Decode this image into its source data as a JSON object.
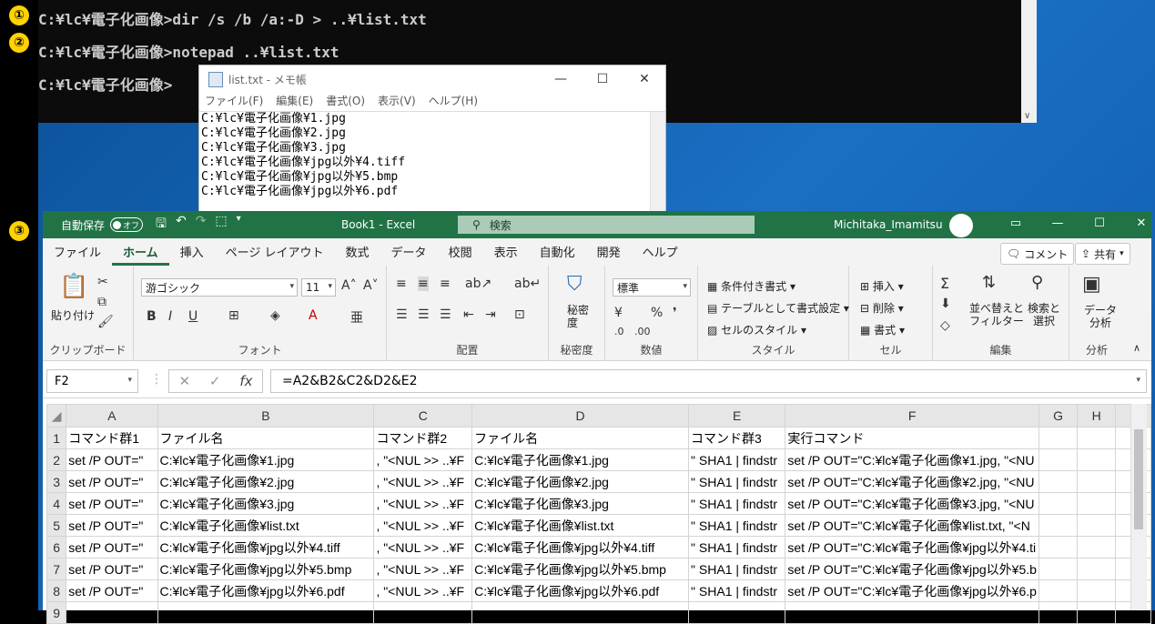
{
  "steps": [
    "①",
    "②",
    "③"
  ],
  "cmd": {
    "lines": [
      "C:¥lc¥電子化画像>dir /s /b /a:-D > ..¥list.txt",
      "C:¥lc¥電子化画像>notepad ..¥list.txt",
      "C:¥lc¥電子化画像>"
    ]
  },
  "notepad": {
    "title": "list.txt - メモ帳",
    "menu": [
      "ファイル(F)",
      "編集(E)",
      "書式(O)",
      "表示(V)",
      "ヘルプ(H)"
    ],
    "content": "C:¥lc¥電子化画像¥1.jpg\nC:¥lc¥電子化画像¥2.jpg\nC:¥lc¥電子化画像¥3.jpg\nC:¥lc¥電子化画像¥jpg以外¥4.tiff\nC:¥lc¥電子化画像¥jpg以外¥5.bmp\nC:¥lc¥電子化画像¥jpg以外¥6.pdf"
  },
  "excel": {
    "autosave_label": "自動保存",
    "autosave_state": "オフ",
    "doc_title": "Book1 - Excel",
    "search_placeholder": "検索",
    "user": "Michitaka_Imamitsu",
    "tabs": [
      "ファイル",
      "ホーム",
      "挿入",
      "ページ レイアウト",
      "数式",
      "データ",
      "校閲",
      "表示",
      "自動化",
      "開発",
      "ヘルプ"
    ],
    "comment_button": "コメント",
    "share_button": "共有",
    "ribbon": {
      "paste": "貼り付け",
      "clipboard": "クリップボード",
      "font_name": "游ゴシック",
      "font_size": "11",
      "font": "フォント",
      "alignment": "配置",
      "confidential": "秘密度",
      "confidential_btn": "秘密\n度",
      "number_format": "標準",
      "number": "数値",
      "conditional": "条件付き書式",
      "as_table": "テーブルとして書式設定",
      "cell_style": "セルのスタイル",
      "style": "スタイル",
      "insert": "挿入",
      "delete": "削除",
      "format": "書式",
      "cells": "セル",
      "sort_filter": "並べ替えと\nフィルター",
      "find_select": "検索と\n選択",
      "editing": "編集",
      "analyze_data": "データ\n分析",
      "analysis": "分析"
    },
    "name_box": "F2",
    "formula": "=A2&B2&C2&D2&E2",
    "columns": [
      "A",
      "B",
      "C",
      "D",
      "E",
      "F",
      "G",
      "H",
      "I"
    ],
    "rows": [
      {
        "n": "1",
        "cells": [
          "コマンド群1",
          "ファイル名",
          "コマンド群2",
          "ファイル名",
          "コマンド群3",
          "実行コマンド",
          "",
          "",
          ""
        ]
      },
      {
        "n": "2",
        "cells": [
          "set /P OUT=\"",
          "C:¥lc¥電子化画像¥1.jpg",
          ", \"<NUL >> ..¥F",
          "C:¥lc¥電子化画像¥1.jpg",
          "\" SHA1 | findstr",
          "set /P OUT=\"C:¥lc¥電子化画像¥1.jpg, \"<NU",
          "",
          "",
          ""
        ]
      },
      {
        "n": "3",
        "cells": [
          "set /P OUT=\"",
          "C:¥lc¥電子化画像¥2.jpg",
          ", \"<NUL >> ..¥F",
          "C:¥lc¥電子化画像¥2.jpg",
          "\" SHA1 | findstr",
          "set /P OUT=\"C:¥lc¥電子化画像¥2.jpg, \"<NU",
          "",
          "",
          ""
        ]
      },
      {
        "n": "4",
        "cells": [
          "set /P OUT=\"",
          "C:¥lc¥電子化画像¥3.jpg",
          ", \"<NUL >> ..¥F",
          "C:¥lc¥電子化画像¥3.jpg",
          "\" SHA1 | findstr",
          "set /P OUT=\"C:¥lc¥電子化画像¥3.jpg, \"<NU",
          "",
          "",
          ""
        ]
      },
      {
        "n": "5",
        "cells": [
          "set /P OUT=\"",
          "C:¥lc¥電子化画像¥list.txt",
          ", \"<NUL >> ..¥F",
          "C:¥lc¥電子化画像¥list.txt",
          "\" SHA1 | findstr",
          "set /P OUT=\"C:¥lc¥電子化画像¥list.txt, \"<N",
          "",
          "",
          ""
        ]
      },
      {
        "n": "6",
        "cells": [
          "set /P OUT=\"",
          "C:¥lc¥電子化画像¥jpg以外¥4.tiff",
          ", \"<NUL >> ..¥F",
          "C:¥lc¥電子化画像¥jpg以外¥4.tiff",
          "\" SHA1 | findstr",
          "set /P OUT=\"C:¥lc¥電子化画像¥jpg以外¥4.ti",
          "",
          "",
          ""
        ]
      },
      {
        "n": "7",
        "cells": [
          "set /P OUT=\"",
          "C:¥lc¥電子化画像¥jpg以外¥5.bmp",
          ", \"<NUL >> ..¥F",
          "C:¥lc¥電子化画像¥jpg以外¥5.bmp",
          "\" SHA1 | findstr",
          "set /P OUT=\"C:¥lc¥電子化画像¥jpg以外¥5.b",
          "",
          "",
          ""
        ]
      },
      {
        "n": "8",
        "cells": [
          "set /P OUT=\"",
          "C:¥lc¥電子化画像¥jpg以外¥6.pdf",
          ", \"<NUL >> ..¥F",
          "C:¥lc¥電子化画像¥jpg以外¥6.pdf",
          "\" SHA1 | findstr",
          "set /P OUT=\"C:¥lc¥電子化画像¥jpg以外¥6.p",
          "",
          "",
          ""
        ]
      },
      {
        "n": "9",
        "cells": [
          "",
          "",
          "",
          "",
          "",
          "",
          "",
          "",
          ""
        ]
      }
    ]
  }
}
